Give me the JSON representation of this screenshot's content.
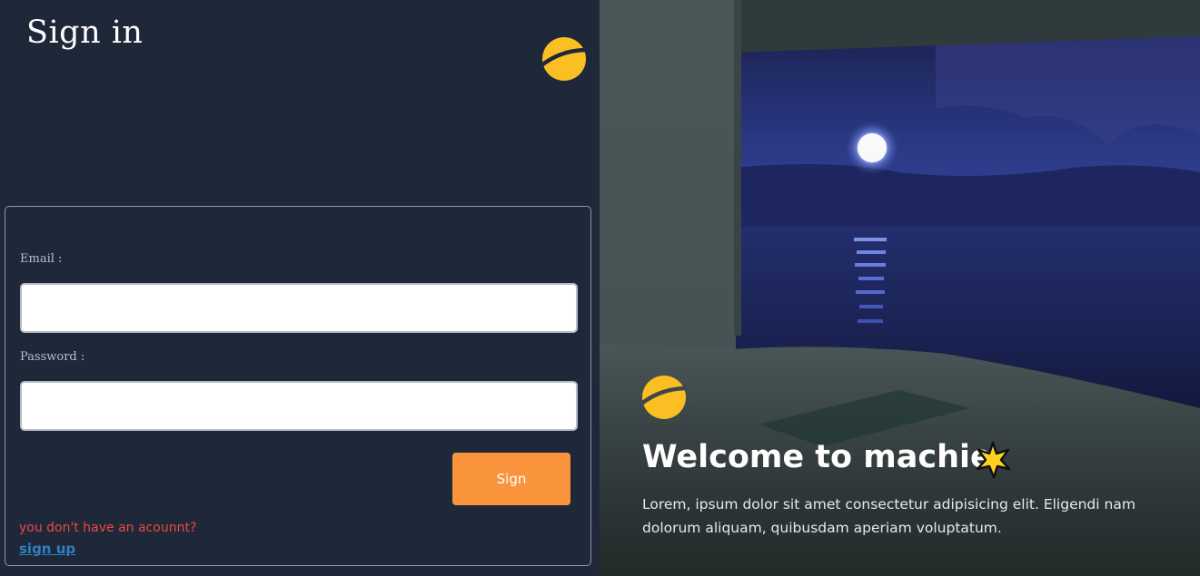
{
  "left": {
    "title": "Sign in",
    "logo_icon": "half-moon-logo-icon",
    "form": {
      "email_label": "Email :",
      "email_value": "",
      "email_placeholder": "",
      "password_label": "Password :",
      "password_value": "",
      "password_placeholder": "",
      "submit_label": "Sign",
      "no_account_text": "you don't have an acounnt?",
      "signup_link": "sign up"
    }
  },
  "right": {
    "background_icon": "night-pool-moon-image",
    "logo_icon": "half-moon-logo-icon",
    "welcome_title": "Welcome to machie",
    "welcome_icon": "star-icon",
    "welcome_text": "Lorem, ipsum dolor sit amet consectetur adipisicing elit. Eligendi nam dolorum aliquam, quibusdam aperiam voluptatum."
  },
  "colors": {
    "panel_bg": "#1f2838",
    "accent": "#fbbf24",
    "button": "#f9943d",
    "error_text": "#e8494a",
    "link": "#2f7fc3"
  }
}
